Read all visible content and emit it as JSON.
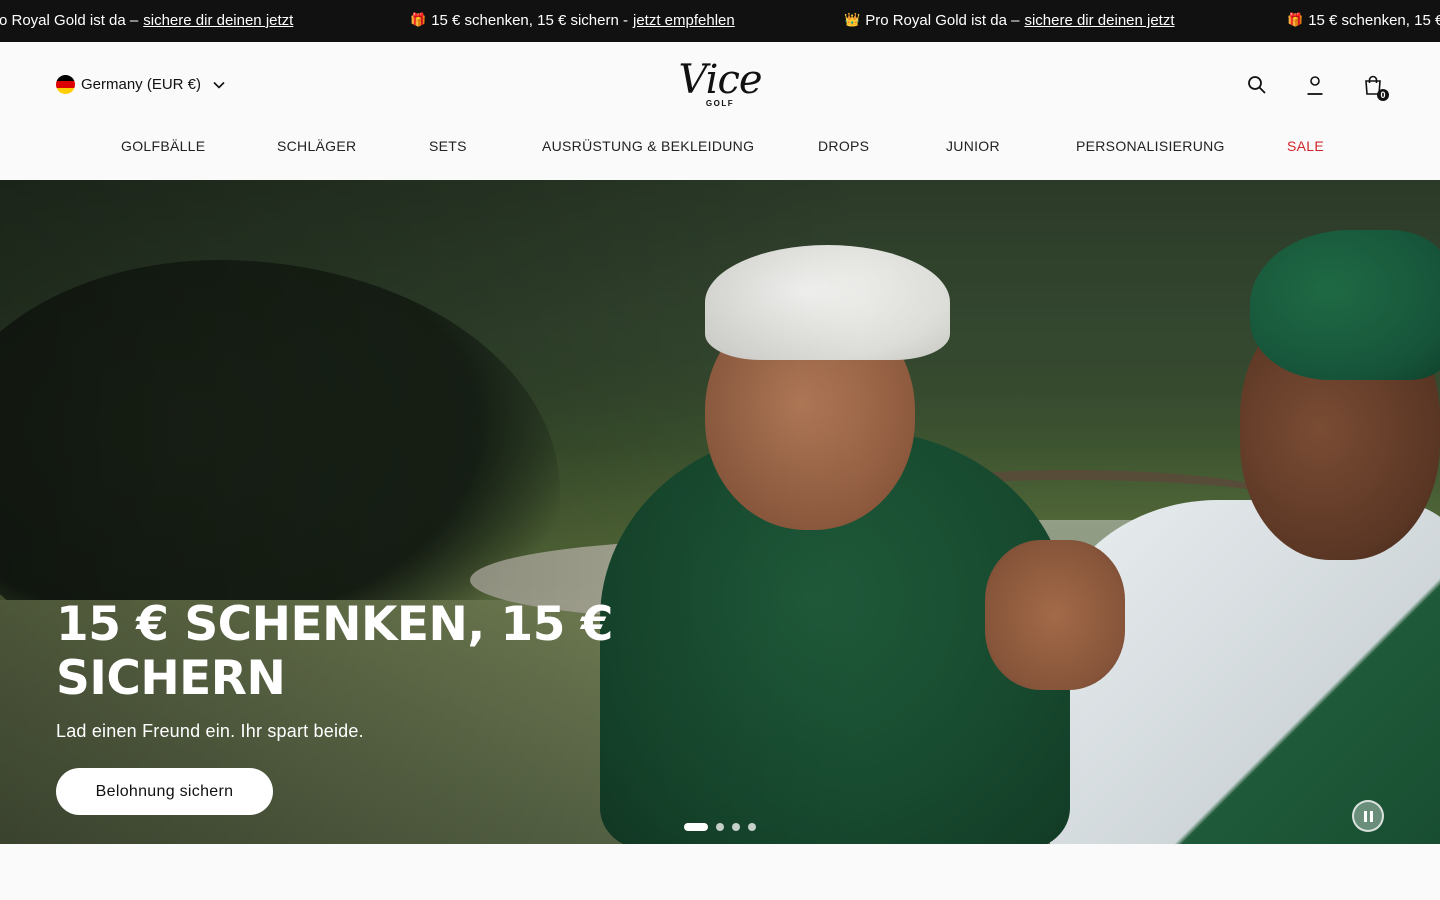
{
  "announcement": {
    "items": [
      {
        "emoji": "",
        "text": "ro Royal Gold ist da –",
        "link": "sichere dir deinen jetzt"
      },
      {
        "emoji": "🎁",
        "text": "15 € schenken, 15 € sichern -",
        "link": "jetzt empfehlen"
      },
      {
        "emoji": "👑",
        "text": "Pro Royal Gold ist da –",
        "link": "sichere dir deinen jetzt"
      },
      {
        "emoji": "🎁",
        "text": "15 € schenken, 15 €",
        "link": ""
      }
    ]
  },
  "header": {
    "locale": "Germany (EUR €)",
    "logo": {
      "main": "Vice",
      "sub": "GOLF"
    },
    "cart_count": "0",
    "icons": [
      "search-icon",
      "account-icon",
      "cart-icon"
    ]
  },
  "nav": {
    "items": [
      "GOLFBÄLLE",
      "SCHLÄGER",
      "SETS",
      "AUSRÜSTUNG & BEKLEIDUNG",
      "DROPS",
      "JUNIOR",
      "PERSONALISIERUNG",
      "SALE"
    ]
  },
  "hero": {
    "title": "15 € SCHENKEN, 15 € SICHERN",
    "subtitle": "Lad einen Freund ein. Ihr spart beide.",
    "cta": "Belohnung sichern",
    "slides_total": 4,
    "active_slide": 1
  },
  "colors": {
    "announcement_bg": "#111111",
    "sale": "#d0262b",
    "cta_bg": "#ffffff"
  }
}
